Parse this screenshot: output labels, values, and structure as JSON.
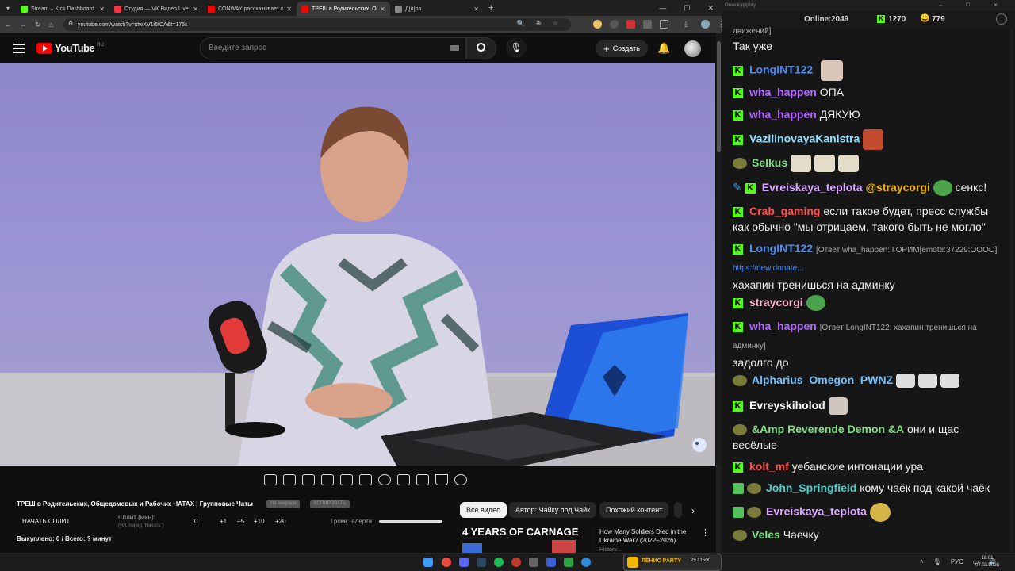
{
  "browser": {
    "tabs": [
      {
        "title": "Stream – Kick Dashboard",
        "color": "#53fc18"
      },
      {
        "title": "Студия — VK Видео Live",
        "color": "#ff3347"
      },
      {
        "title": "CONWAY рассказывает как м",
        "color": "#ff0000"
      },
      {
        "title": "ТРЕШ в Родительских, Об",
        "color": "#ff0000"
      },
      {
        "title": "Д[и]ра",
        "color": "#888888"
      }
    ],
    "url": "youtube.com/watch?v=stwXV1i6tCA&t=176s"
  },
  "youtube": {
    "logo_text": "YouTube",
    "region": "RU",
    "search_placeholder": "Введите запрос",
    "create_label": "Создать",
    "video_title": "ТРЕШ в Родительских, Общедомовых и Рабочих ЧАТАХ | Групповые Чаты",
    "badge_1": "На очереди",
    "badge_2": "КОПИРОВАТЬ",
    "start_split": "НАЧАТЬ СПЛИТ",
    "split_label": "Сплит (мин):",
    "split_hint": "(уст. перед \"Начать\")",
    "split_values": [
      "0",
      "+1",
      "+5",
      "+10",
      "+20"
    ],
    "volume_label": "Громк. алерта:",
    "bought_line": "Выкуплено: 0 / Всего: ? минут",
    "chips": [
      "Все видео",
      "Автор: Чайку под Чайк",
      "Похожий контент"
    ],
    "rec_thumb_text": "4 YEARS OF CARNAGE",
    "rec_title": "How Many Soldiers Died in the Ukraine War? (2022–2026)",
    "rec_channel": "History..."
  },
  "chat": {
    "window_title": "Окно в дорогу",
    "online_label": "Online:",
    "online_count": "2049",
    "kick_count": "1270",
    "other_count": "779",
    "messages": [
      {
        "nick": "",
        "text": "движений]",
        "color": "#aaaaaa"
      },
      {
        "nick": "",
        "text": "Так уже",
        "color": "#eeeeee"
      },
      {
        "nick": "LongINT122",
        "text": "",
        "color": "#4a8df8"
      },
      {
        "nick": "wha_happen",
        "text": "ОПА",
        "color": "#b266ff"
      },
      {
        "nick": "wha_happen",
        "text": "ДЯКУЮ",
        "color": "#b266ff"
      },
      {
        "nick": "VazilinovayaKanistra",
        "text": "",
        "color": "#8fe0ff"
      },
      {
        "nick": "Selkus",
        "text": "",
        "color": "#7ee081"
      },
      {
        "nick": "Evreiskaya_teplota",
        "text": "@straycorgi",
        "tail": "сенкс!",
        "color": "#d9a8ff"
      },
      {
        "nick": "Crab_gaming",
        "text": "если такое будет, пресс службы как обычно \"мы отрицаем, такого быть не могло\"",
        "color": "#ff4f4f"
      },
      {
        "nick": "LongINT122",
        "reply": "[Ответ wha_happen: ГОРИМ[emote:37229:OOOO]",
        "link": "https://new.donate...",
        "text": "хахапин тренишься на админку",
        "color": "#4a8df8"
      },
      {
        "nick": "straycorgi",
        "text": "",
        "color": "#ffb3d1"
      },
      {
        "nick": "wha_happen",
        "reply": "[Ответ LongINT122: хахапин тренишься на админку]",
        "text": "задолго до",
        "color": "#b266ff"
      },
      {
        "nick": "Alpharius_Omegon_PWNZ",
        "text": "",
        "color": "#6fc2ff"
      },
      {
        "nick": "Evreyskiholod",
        "text": "",
        "color": "#ffffff"
      },
      {
        "nick": "&Amp Reverende Demon &A",
        "text": "они и щас весёлые",
        "color": "#7ee081"
      },
      {
        "nick": "kolt_mf",
        "text": "уебанские интонации ура",
        "color": "#ff4f4f"
      },
      {
        "nick": "John_Springfield",
        "text": "кому чаёк под какой чаёк",
        "color": "#4ad1d1"
      },
      {
        "nick": "Evreiskaya_teplota",
        "text": "",
        "color": "#d9a8ff"
      },
      {
        "nick": "Veles",
        "text": "Чаечку",
        "color": "#7ee081"
      }
    ]
  },
  "taskbar": {
    "widget_text": "ЛЁНИС PARTY",
    "widget_count": "25 / 1500",
    "lang": "РУС",
    "time": "18:01",
    "date": "07.03.2026"
  },
  "colors": {
    "accent": "#ff0000",
    "kick": "#53fc18"
  }
}
